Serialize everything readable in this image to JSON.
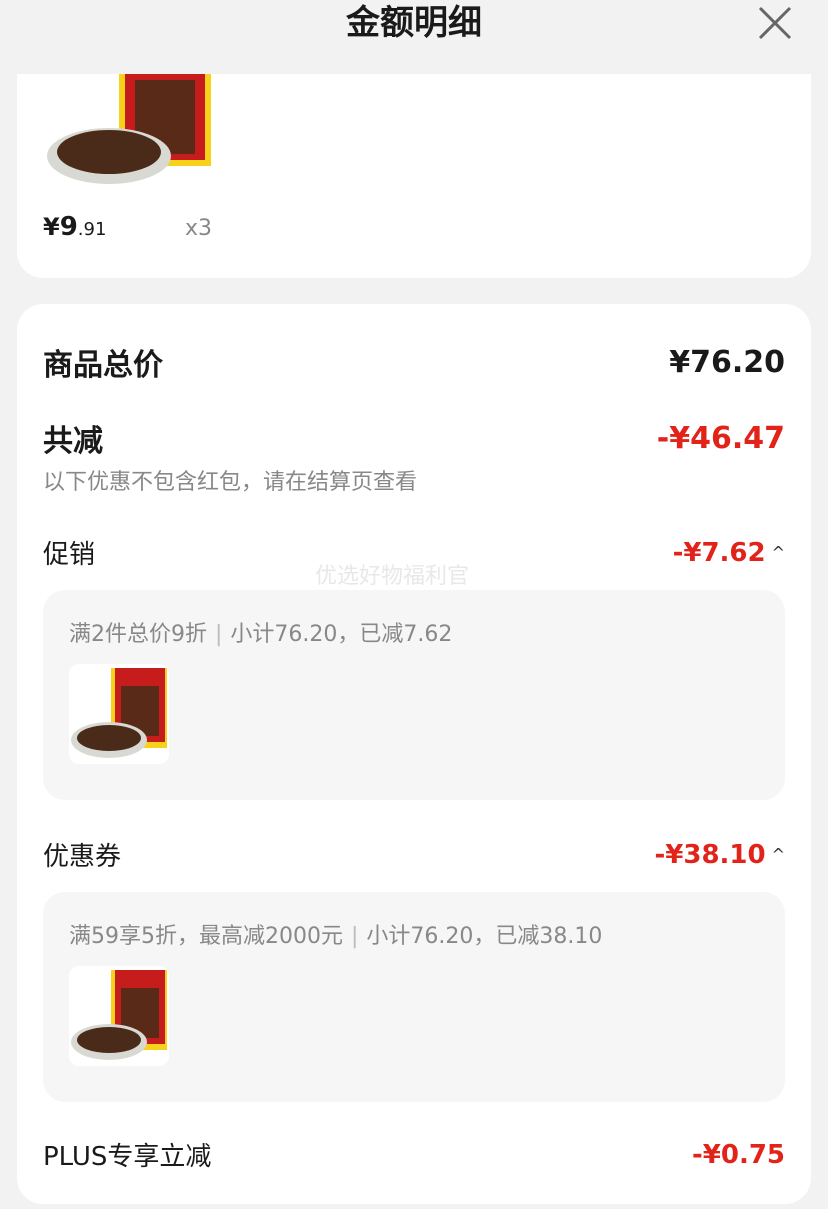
{
  "header": {
    "title": "金额明细"
  },
  "top_item": {
    "price_yen": "¥",
    "price_int": "9",
    "price_dec": ".91",
    "qty": "x3"
  },
  "summary": {
    "total_label": "商品总价",
    "total_value": "¥76.20",
    "discount_label": "共减",
    "discount_value": "-¥46.47",
    "note": "以下优惠不包含红包，请在结算页查看"
  },
  "promo": {
    "label": "促销",
    "value": "-¥7.62",
    "rule": "满2件总价9折",
    "detail": "小计76.20，已减7.62"
  },
  "watermark": "优选好物福利官",
  "coupon": {
    "label": "优惠券",
    "value": "-¥38.10",
    "rule": "满59享5折，最高减2000元",
    "detail": "小计76.20，已减38.10"
  },
  "plus": {
    "label": "PLUS专享立减",
    "value": "-¥0.75"
  },
  "colors": {
    "accent_red": "#e2231a",
    "bg": "#f2f2f2"
  }
}
